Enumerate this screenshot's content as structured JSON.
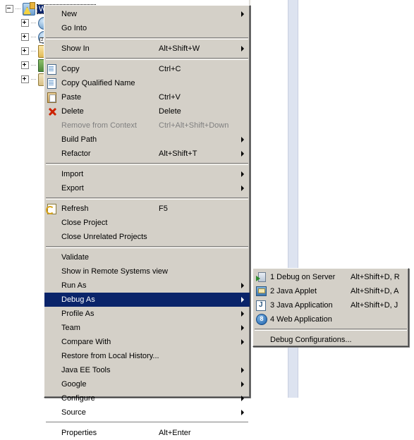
{
  "workbench": {
    "tree": {
      "nodes": [
        {
          "label": "WebGLTutorials",
          "icon": "project-icon",
          "selected": true,
          "expanded": true,
          "indent": 8,
          "warning": true
        },
        {
          "label": "",
          "icon": "globe-icon",
          "selected": false,
          "expanded": false,
          "indent": 30,
          "warning": false
        },
        {
          "label": "",
          "icon": "library-icon",
          "selected": false,
          "expanded": false,
          "indent": 30,
          "warning": false
        },
        {
          "label": "",
          "icon": "folder-icon",
          "selected": false,
          "expanded": false,
          "indent": 30,
          "warning": false
        },
        {
          "label": "",
          "icon": "books-icon",
          "selected": false,
          "expanded": false,
          "indent": 30,
          "warning": false
        },
        {
          "label": "",
          "icon": "jar-icon",
          "selected": false,
          "expanded": false,
          "indent": 30,
          "warning": false
        }
      ]
    }
  },
  "context_menu": {
    "name": "project-context-menu",
    "items": [
      {
        "kind": "item",
        "label": "New",
        "accel": "",
        "icon": "",
        "arrow": true,
        "disabled": false,
        "selected": false
      },
      {
        "kind": "item",
        "label": "Go Into",
        "accel": "",
        "icon": "",
        "arrow": false,
        "disabled": false,
        "selected": false
      },
      {
        "kind": "separator"
      },
      {
        "kind": "item",
        "label": "Show In",
        "accel": "Alt+Shift+W",
        "icon": "",
        "arrow": true,
        "disabled": false,
        "selected": false
      },
      {
        "kind": "separator"
      },
      {
        "kind": "item",
        "label": "Copy",
        "accel": "Ctrl+C",
        "icon": "copy-icon",
        "arrow": false,
        "disabled": false,
        "selected": false
      },
      {
        "kind": "item",
        "label": "Copy Qualified Name",
        "accel": "",
        "icon": "copy-qualified-icon",
        "arrow": false,
        "disabled": false,
        "selected": false
      },
      {
        "kind": "item",
        "label": "Paste",
        "accel": "Ctrl+V",
        "icon": "paste-icon",
        "arrow": false,
        "disabled": false,
        "selected": false
      },
      {
        "kind": "item",
        "label": "Delete",
        "accel": "Delete",
        "icon": "delete-icon",
        "arrow": false,
        "disabled": false,
        "selected": false
      },
      {
        "kind": "item",
        "label": "Remove from Context",
        "accel": "Ctrl+Alt+Shift+Down",
        "icon": "",
        "arrow": false,
        "disabled": true,
        "selected": false
      },
      {
        "kind": "item",
        "label": "Build Path",
        "accel": "",
        "icon": "",
        "arrow": true,
        "disabled": false,
        "selected": false
      },
      {
        "kind": "item",
        "label": "Refactor",
        "accel": "Alt+Shift+T",
        "icon": "",
        "arrow": true,
        "disabled": false,
        "selected": false
      },
      {
        "kind": "separator"
      },
      {
        "kind": "item",
        "label": "Import",
        "accel": "",
        "icon": "",
        "arrow": true,
        "disabled": false,
        "selected": false
      },
      {
        "kind": "item",
        "label": "Export",
        "accel": "",
        "icon": "",
        "arrow": true,
        "disabled": false,
        "selected": false
      },
      {
        "kind": "separator"
      },
      {
        "kind": "item",
        "label": "Refresh",
        "accel": "F5",
        "icon": "refresh-icon",
        "arrow": false,
        "disabled": false,
        "selected": false
      },
      {
        "kind": "item",
        "label": "Close Project",
        "accel": "",
        "icon": "",
        "arrow": false,
        "disabled": false,
        "selected": false
      },
      {
        "kind": "item",
        "label": "Close Unrelated Projects",
        "accel": "",
        "icon": "",
        "arrow": false,
        "disabled": false,
        "selected": false
      },
      {
        "kind": "separator"
      },
      {
        "kind": "item",
        "label": "Validate",
        "accel": "",
        "icon": "",
        "arrow": false,
        "disabled": false,
        "selected": false
      },
      {
        "kind": "item",
        "label": "Show in Remote Systems view",
        "accel": "",
        "icon": "",
        "arrow": false,
        "disabled": false,
        "selected": false
      },
      {
        "kind": "item",
        "label": "Run As",
        "accel": "",
        "icon": "",
        "arrow": true,
        "disabled": false,
        "selected": false
      },
      {
        "kind": "item",
        "label": "Debug As",
        "accel": "",
        "icon": "",
        "arrow": true,
        "disabled": false,
        "selected": true
      },
      {
        "kind": "item",
        "label": "Profile As",
        "accel": "",
        "icon": "",
        "arrow": true,
        "disabled": false,
        "selected": false
      },
      {
        "kind": "item",
        "label": "Team",
        "accel": "",
        "icon": "",
        "arrow": true,
        "disabled": false,
        "selected": false
      },
      {
        "kind": "item",
        "label": "Compare With",
        "accel": "",
        "icon": "",
        "arrow": true,
        "disabled": false,
        "selected": false
      },
      {
        "kind": "item",
        "label": "Restore from Local History...",
        "accel": "",
        "icon": "",
        "arrow": false,
        "disabled": false,
        "selected": false
      },
      {
        "kind": "item",
        "label": "Java EE Tools",
        "accel": "",
        "icon": "",
        "arrow": true,
        "disabled": false,
        "selected": false
      },
      {
        "kind": "item",
        "label": "Google",
        "accel": "",
        "icon": "",
        "arrow": true,
        "disabled": false,
        "selected": false
      },
      {
        "kind": "item",
        "label": "Configure",
        "accel": "",
        "icon": "",
        "arrow": true,
        "disabled": false,
        "selected": false
      },
      {
        "kind": "item",
        "label": "Source",
        "accel": "",
        "icon": "",
        "arrow": true,
        "disabled": false,
        "selected": false
      },
      {
        "kind": "separator"
      },
      {
        "kind": "item",
        "label": "Properties",
        "accel": "Alt+Enter",
        "icon": "",
        "arrow": false,
        "disabled": false,
        "selected": false
      }
    ]
  },
  "debug_submenu": {
    "name": "debug-as-submenu",
    "items": [
      {
        "kind": "item",
        "label": "1 Debug on Server",
        "accel": "Alt+Shift+D, R",
        "icon": "debug-server-icon",
        "disabled": false
      },
      {
        "kind": "item",
        "label": "2 Java Applet",
        "accel": "Alt+Shift+D, A",
        "icon": "java-applet-icon",
        "disabled": false
      },
      {
        "kind": "item",
        "label": "3 Java Application",
        "accel": "Alt+Shift+D, J",
        "icon": "java-app-icon",
        "disabled": false
      },
      {
        "kind": "item",
        "label": "4 Web Application",
        "accel": "",
        "icon": "web-app-icon",
        "disabled": false
      },
      {
        "kind": "separator"
      },
      {
        "kind": "item",
        "label": "Debug Configurations...",
        "accel": "",
        "icon": "",
        "disabled": false
      }
    ]
  },
  "colors": {
    "menu_face": "#d4d0c8",
    "selection": "#0a246a",
    "selection_text": "#ffffff",
    "disabled_text": "#808080",
    "editor_strip": "#dde3f0"
  }
}
